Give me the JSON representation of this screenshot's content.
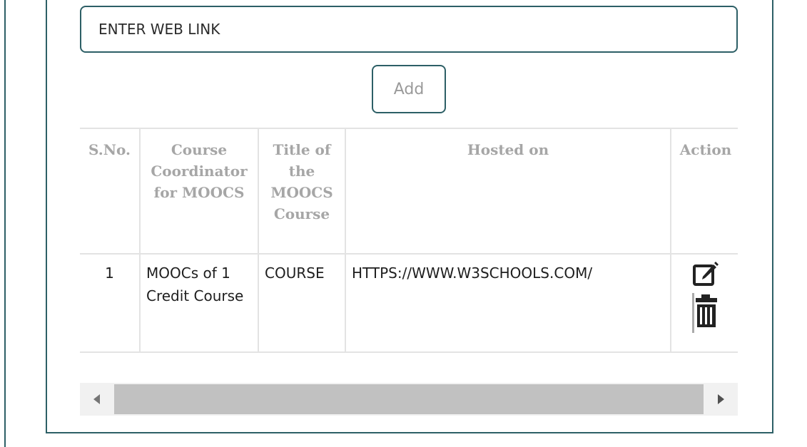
{
  "form": {
    "web_link_value": "ENTER WEB LINK",
    "add_label": "Add"
  },
  "table": {
    "headers": {
      "sno": "S.No.",
      "coordinator": "Course Coordinator for MOOCS",
      "title": "Title of the MOOCS Course",
      "hosted": "Hosted on",
      "action": "Action"
    },
    "rows": [
      {
        "sno": "1",
        "coordinator": "MOOCs of 1 Credit Course",
        "title": "COURSE",
        "hosted": "HTTPS://WWW.W3SCHOOLS.COM/"
      }
    ]
  },
  "icons": {
    "edit": "edit-icon",
    "delete": "trash-icon",
    "scroll_left": "scroll-left-arrow-icon",
    "scroll_right": "scroll-right-arrow-icon"
  },
  "colors": {
    "border_accent": "#2d5f66",
    "header_text": "#a6a6a6",
    "table_border": "#e3e3e3",
    "scroll_track": "#f1f1f1",
    "scroll_thumb": "#c1c1c1"
  }
}
